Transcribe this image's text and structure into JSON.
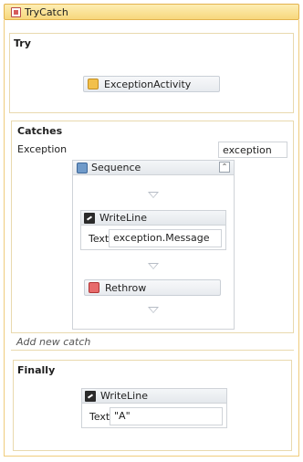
{
  "title": "TryCatch",
  "try_section": {
    "title": "Try",
    "activity_label": "ExceptionActivity"
  },
  "catches_section": {
    "title": "Catches",
    "exception_label": "Exception",
    "exception_variable": "exception",
    "sequence_label": "Sequence",
    "writeline": {
      "title": "WriteLine",
      "field_label": "Text",
      "value": "exception.Message"
    },
    "rethrow_label": "Rethrow"
  },
  "add_new_catch": "Add new catch",
  "finally_section": {
    "title": "Finally",
    "writeline": {
      "title": "WriteLine",
      "field_label": "Text",
      "value": "\"A\""
    }
  },
  "colors": {
    "title_bar": "#f7d77c",
    "section_border": "#e9d9ae",
    "activity_border": "#c9cfd6"
  }
}
